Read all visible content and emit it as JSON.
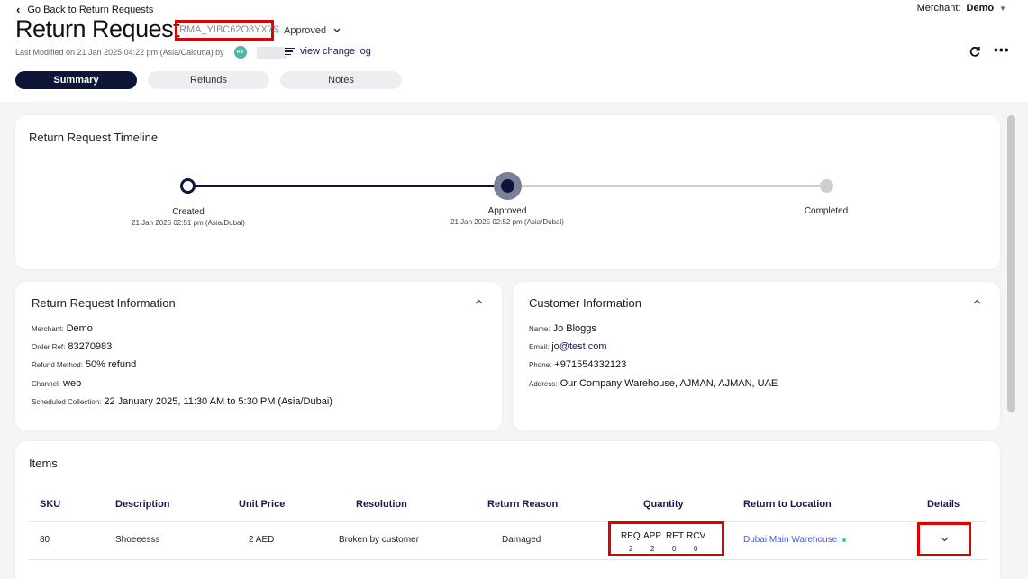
{
  "header": {
    "back_label": "Go Back to Return Requests",
    "merchant_label": "Merchant:",
    "merchant_value": "Demo",
    "title": "Return Request",
    "rma": "RMA_YIBC62O8YX7S",
    "status": "Approved",
    "last_modified": "Last Modified on 21 Jan 2025 04:22 pm (Asia/Calcutta) by",
    "avatar_initials": "RA",
    "change_log": "view change log"
  },
  "tabs": [
    "Summary",
    "Refunds",
    "Notes"
  ],
  "timeline": {
    "title": "Return Request Timeline",
    "steps": [
      {
        "label": "Created",
        "date": "21 Jan 2025 02:51 pm (Asia/Dubai)"
      },
      {
        "label": "Approved",
        "date": "21 Jan 2025 02:52 pm (Asia/Dubai)"
      },
      {
        "label": "Completed",
        "date": ""
      }
    ]
  },
  "return_info": {
    "title": "Return Request Information",
    "rows": [
      {
        "key": "Merchant:",
        "value": "Demo"
      },
      {
        "key": "Order Ref:",
        "value": "83270983"
      },
      {
        "key": "Refund Method:",
        "value": "50% refund"
      },
      {
        "key": "Channel:",
        "value": "web"
      },
      {
        "key": "Scheduled Collection:",
        "value": "22 January 2025, 11:30 AM to 5:30 PM (Asia/Dubai)"
      }
    ]
  },
  "customer_info": {
    "title": "Customer Information",
    "rows": [
      {
        "key": "Name:",
        "value": "Jo Bloggs"
      },
      {
        "key": "Email:",
        "value": "jo@test.com"
      },
      {
        "key": "Phone:",
        "value": "+971554332123"
      },
      {
        "key": "Address:",
        "value": "Our Company Warehouse, AJMAN, AJMAN, UAE"
      }
    ]
  },
  "items": {
    "title": "Items",
    "columns": [
      "SKU",
      "Description",
      "Unit Price",
      "Resolution",
      "Return Reason",
      "Quantity",
      "Return to Location",
      "Details"
    ],
    "rows": [
      {
        "sku": "80",
        "description": "Shoeeesss",
        "unit_price": "2 AED",
        "resolution": "Broken by customer",
        "reason": "Damaged",
        "quantity": {
          "labels": [
            "REQ",
            "APP",
            "RET",
            "RCV"
          ],
          "values": [
            "2",
            "2",
            "0",
            "0"
          ]
        },
        "location": "Dubai Main Warehouse"
      }
    ]
  },
  "colors": {
    "accent": "#0f1538",
    "highlight": "#e00000",
    "link": "#4a5bd6",
    "online": "#2fd38f"
  }
}
